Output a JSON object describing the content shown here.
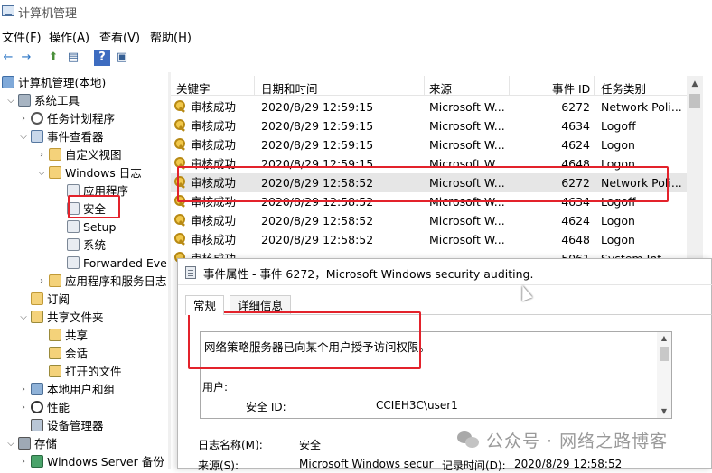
{
  "window": {
    "title": "计算机管理"
  },
  "menu": [
    "文件(F)",
    "操作(A)",
    "查看(V)",
    "帮助(H)"
  ],
  "toolbar": {
    "back": "←",
    "forward": "→",
    "up": "⬆",
    "view": "▤",
    "help": "?",
    "props": "▣"
  },
  "tree": [
    {
      "label": "计算机管理(本地)",
      "icon": "computer-icon",
      "expander": ""
    },
    {
      "label": "系统工具",
      "icon": "tools-icon",
      "expander": "⌵"
    },
    {
      "label": "任务计划程序",
      "icon": "clock-icon",
      "expander": "›"
    },
    {
      "label": "事件查看器",
      "icon": "event-viewer-icon",
      "expander": "⌵"
    },
    {
      "label": "自定义视图",
      "icon": "folder-icon",
      "expander": "›"
    },
    {
      "label": "Windows 日志",
      "icon": "folder-icon",
      "expander": "⌵"
    },
    {
      "label": "应用程序",
      "icon": "log-icon",
      "expander": ""
    },
    {
      "label": "安全",
      "icon": "log-icon",
      "expander": ""
    },
    {
      "label": "Setup",
      "icon": "log-icon",
      "expander": ""
    },
    {
      "label": "系统",
      "icon": "log-icon",
      "expander": ""
    },
    {
      "label": "Forwarded Events",
      "icon": "log-icon",
      "expander": ""
    },
    {
      "label": "应用程序和服务日志",
      "icon": "folder-icon",
      "expander": "›"
    },
    {
      "label": "订阅",
      "icon": "subscription-icon",
      "expander": ""
    },
    {
      "label": "共享文件夹",
      "icon": "shared-folder-icon",
      "expander": "⌵"
    },
    {
      "label": "共享",
      "icon": "shared-folder-icon",
      "expander": ""
    },
    {
      "label": "会话",
      "icon": "shared-folder-icon",
      "expander": ""
    },
    {
      "label": "打开的文件",
      "icon": "shared-folder-icon",
      "expander": ""
    },
    {
      "label": "本地用户和组",
      "icon": "users-icon",
      "expander": "›"
    },
    {
      "label": "性能",
      "icon": "performance-icon",
      "expander": "›"
    },
    {
      "label": "设备管理器",
      "icon": "device-manager-icon",
      "expander": ""
    },
    {
      "label": "存储",
      "icon": "storage-icon",
      "expander": "⌵"
    },
    {
      "label": "Windows Server 备份",
      "icon": "backup-icon",
      "expander": "›"
    }
  ],
  "list": {
    "columns": [
      "关键字",
      "日期和时间",
      "来源",
      "事件 ID",
      "任务类别"
    ],
    "rows": [
      {
        "keyword": "审核成功",
        "datetime": "2020/8/29 12:59:15",
        "source": "Microsoft W...",
        "event_id": "6272",
        "category": "Network Poli..."
      },
      {
        "keyword": "审核成功",
        "datetime": "2020/8/29 12:59:15",
        "source": "Microsoft W...",
        "event_id": "4634",
        "category": "Logoff"
      },
      {
        "keyword": "审核成功",
        "datetime": "2020/8/29 12:59:15",
        "source": "Microsoft W...",
        "event_id": "4624",
        "category": "Logon"
      },
      {
        "keyword": "审核成功",
        "datetime": "2020/8/29 12:59:15",
        "source": "Microsoft W...",
        "event_id": "4648",
        "category": "Logon"
      },
      {
        "keyword": "审核成功",
        "datetime": "2020/8/29 12:58:52",
        "source": "Microsoft W...",
        "event_id": "6272",
        "category": "Network Poli..."
      },
      {
        "keyword": "审核成功",
        "datetime": "2020/8/29 12:58:52",
        "source": "Microsoft W...",
        "event_id": "4634",
        "category": "Logoff"
      },
      {
        "keyword": "审核成功",
        "datetime": "2020/8/29 12:58:52",
        "source": "Microsoft W...",
        "event_id": "4624",
        "category": "Logon"
      },
      {
        "keyword": "审核成功",
        "datetime": "2020/8/29 12:58:52",
        "source": "Microsoft W...",
        "event_id": "4648",
        "category": "Logon"
      },
      {
        "keyword": "审核成功",
        "datetime": "",
        "source": "",
        "event_id": "5061",
        "category": "System Int..."
      }
    ]
  },
  "dialog": {
    "title": "事件属性 - 事件 6272，Microsoft Windows security auditing.",
    "tabs": [
      "常规",
      "详细信息"
    ],
    "description": "网络策略服务器已向某个用户授予访问权限。",
    "user_label": "用户:",
    "security_id_label": "安全 ID:",
    "security_id_value": "CCIEH3C\\user1",
    "log_name_label": "日志名称(M):",
    "log_name_value": "安全",
    "source_label": "来源(S):",
    "source_value": "Microsoft Windows secur",
    "recorded_label": "记录时间(D):",
    "recorded_value": "2020/8/29 12:58:52"
  },
  "watermark": "公众号 · 网络之路博客",
  "colors": {
    "highlight_red": "#e3222b",
    "selected_row": "#e6e6e6"
  }
}
